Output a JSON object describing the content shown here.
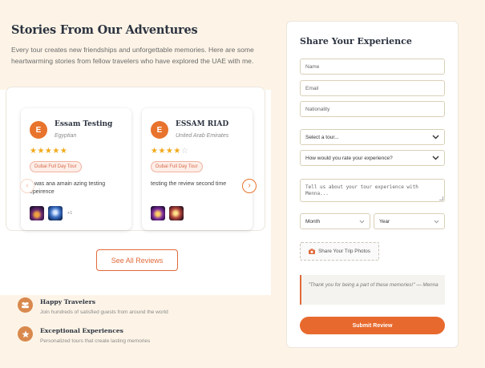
{
  "stories": {
    "title": "Stories From Our Adventures",
    "intro": "Every tour creates new friendships and unforgettable memories. Here are some heartwarming stories from fellow travelers who have explored the UAE with me."
  },
  "reviews": [
    {
      "initial": "E",
      "name": "Essam Testing",
      "origin": "Egyptian",
      "rating": 5,
      "stars": "★★★★★",
      "stars_empty": "",
      "tour": "Dubai Full Day Tour",
      "text": "It was ana amain azing testing epeirence",
      "extra_photos": "+1"
    },
    {
      "initial": "E",
      "name": "ESSAM RIAD",
      "origin": "United Arab Emirates",
      "rating": 4,
      "stars": "★★★★",
      "stars_empty": "☆",
      "tour": "Dubai Full Day Tour",
      "text": "testing the review second time"
    }
  ],
  "carousel": {
    "prev_icon": "‹",
    "next_icon": "›"
  },
  "see_all": "See All Reviews",
  "features": [
    {
      "title": "Happy Travelers",
      "desc": "Join hundreds of satisfied guests from around the world",
      "icon": "group-icon"
    },
    {
      "title": "Exceptional Experiences",
      "desc": "Personalized tours that create lasting memories",
      "icon": "star-icon"
    }
  ],
  "form": {
    "title": "Share Your Experience",
    "name_placeholder": "Name",
    "email_placeholder": "Email",
    "nationality_placeholder": "Nationality",
    "tour_select": "Select a tour...",
    "rating_select": "How would you rate your experience?",
    "story_placeholder": "Tell us about your tour experience with Menna...",
    "month_select": "Month",
    "year_select": "Year",
    "upload_label": "Share Your Trip Photos",
    "quote": "\"Thank you for being a part of these memories!\" — Menna",
    "submit_label": "Submit Review"
  },
  "colors": {
    "accent": "#e8692d",
    "star": "#f2a91b",
    "background": "#fdf4e7"
  }
}
